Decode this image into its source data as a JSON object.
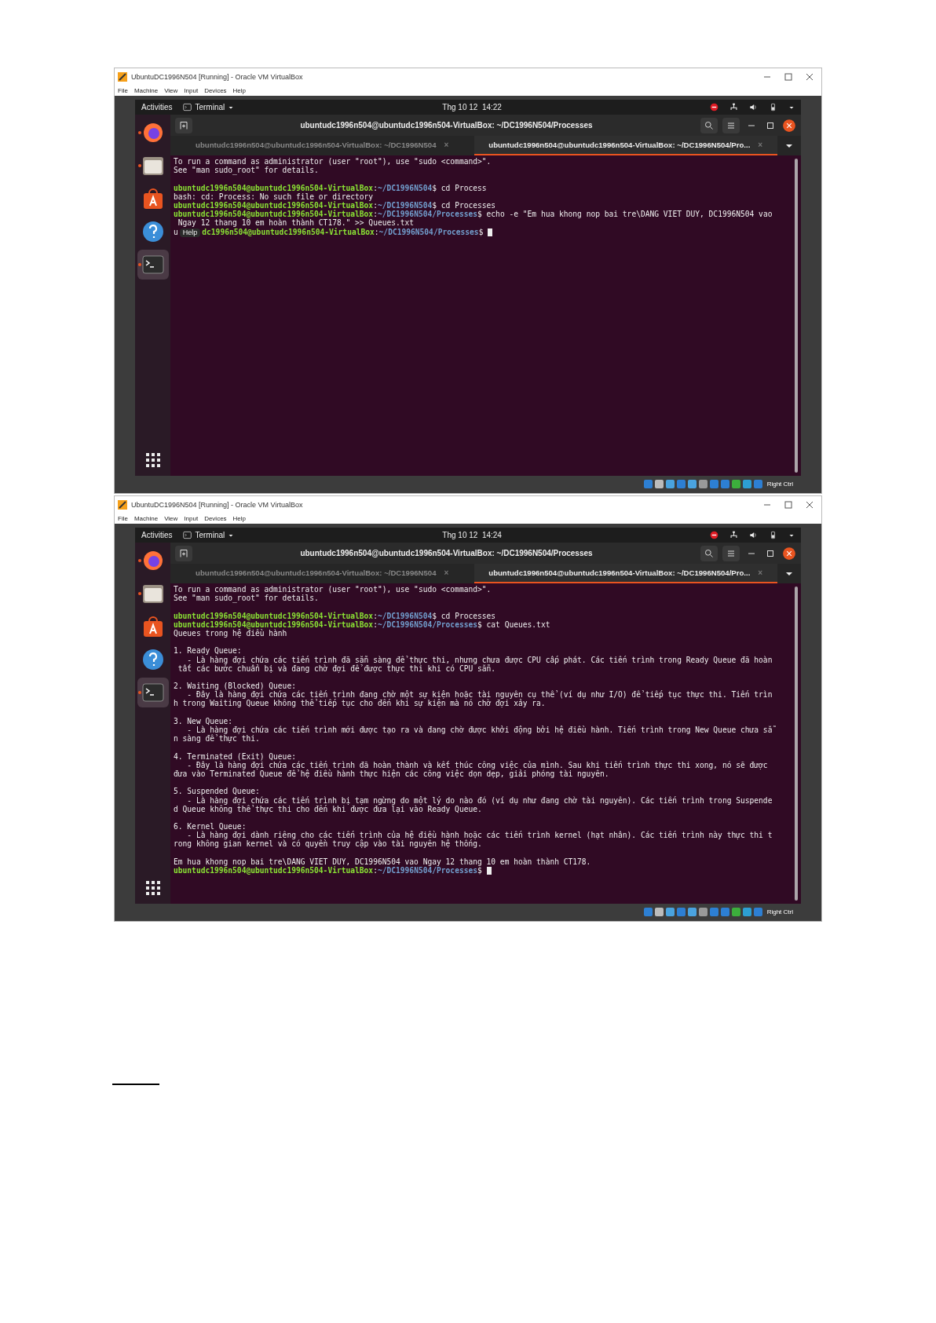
{
  "windows": [
    {
      "title": "UbuntuDC1996N504 [Running] - Oracle VM VirtualBox",
      "menu": [
        "File",
        "Machine",
        "View",
        "Input",
        "Devices",
        "Help"
      ],
      "topbar": {
        "activities": "Activities",
        "app": "Terminal",
        "clock": "Thg 10 12  14:22"
      },
      "dock": [
        {
          "kind": "firefox",
          "running": true,
          "selected": false
        },
        {
          "kind": "files",
          "running": true,
          "selected": false
        },
        {
          "kind": "store",
          "running": false,
          "selected": false
        },
        {
          "kind": "help",
          "running": false,
          "selected": false
        },
        {
          "kind": "terminal",
          "running": true,
          "selected": true
        }
      ],
      "terminal": {
        "title": "ubuntudc1996n504@ubuntudc1996n504-VirtualBox: ~/DC1996N504/Processes",
        "tabs": [
          {
            "label": "ubuntudc1996n504@ubuntudc1996n504-VirtualBox: ~/DC1996N504",
            "close": "×",
            "selected": false
          },
          {
            "label": "ubuntudc1996n504@ubuntudc1996n504-VirtualBox: ~/DC1996N504/Pro...",
            "close": "×",
            "selected": true
          }
        ],
        "lines": [
          {
            "kind": "text",
            "text": "To run a command as administrator (user \"root\"), use \"sudo <command>\"."
          },
          {
            "kind": "text",
            "text": "See \"man sudo_root\" for details."
          },
          {
            "kind": "blank"
          },
          {
            "kind": "prompt",
            "host": "ubuntudc1996n504@ubuntudc1996n504-VirtualBox",
            "sep": ":",
            "path": "~/DC1996N504",
            "command": "$ cd Process"
          },
          {
            "kind": "text",
            "text": "bash: cd: Process: No such file or directory"
          },
          {
            "kind": "prompt",
            "host": "ubuntudc1996n504@ubuntudc1996n504-VirtualBox",
            "sep": ":",
            "path": "~/DC1996N504",
            "command": "$ cd Processes"
          },
          {
            "kind": "prompt",
            "host": "ubuntudc1996n504@ubuntudc1996n504-VirtualBox",
            "sep": ":",
            "path": "~/DC1996N504/Processes",
            "command": "$ echo -e \"Em hua khong nop bai tre\\DANG VIET DUY, DC1996N504 vao"
          },
          {
            "kind": "text",
            "text": " Ngay 12 thang 10 em hoàn thành CT178.\" >> Queues.txt"
          },
          {
            "kind": "prompt",
            "lead": "u",
            "tooltip": "Help",
            "host": "dc1996n504@ubuntudc1996n504-VirtualBox",
            "sep": ":",
            "path": "~/DC1996N504/Processes",
            "command": "$",
            "cursor": true
          }
        ]
      },
      "status": {
        "host_key": "Right Ctrl"
      }
    },
    {
      "title": "UbuntuDC1996N504 [Running] - Oracle VM VirtualBox",
      "menu": [
        "File",
        "Machine",
        "View",
        "Input",
        "Devices",
        "Help"
      ],
      "topbar": {
        "activities": "Activities",
        "app": "Terminal",
        "clock": "Thg 10 12  14:24"
      },
      "dock": [
        {
          "kind": "firefox",
          "running": true,
          "selected": false
        },
        {
          "kind": "files",
          "running": true,
          "selected": false
        },
        {
          "kind": "store",
          "running": false,
          "selected": false
        },
        {
          "kind": "help",
          "running": false,
          "selected": false
        },
        {
          "kind": "terminal",
          "running": true,
          "selected": true
        }
      ],
      "terminal": {
        "title": "ubuntudc1996n504@ubuntudc1996n504-VirtualBox: ~/DC1996N504/Processes",
        "tabs": [
          {
            "label": "ubuntudc1996n504@ubuntudc1996n504-VirtualBox: ~/DC1996N504",
            "close": "×",
            "selected": false
          },
          {
            "label": "ubuntudc1996n504@ubuntudc1996n504-VirtualBox: ~/DC1996N504/Pro...",
            "close": "×",
            "selected": true
          }
        ],
        "lines": [
          {
            "kind": "text",
            "text": "To run a command as administrator (user \"root\"), use \"sudo <command>\"."
          },
          {
            "kind": "text",
            "text": "See \"man sudo_root\" for details."
          },
          {
            "kind": "blank"
          },
          {
            "kind": "prompt",
            "host": "ubuntudc1996n504@ubuntudc1996n504-VirtualBox",
            "sep": ":",
            "path": "~/DC1996N504",
            "command": "$ cd Processes"
          },
          {
            "kind": "prompt",
            "host": "ubuntudc1996n504@ubuntudc1996n504-VirtualBox",
            "sep": ":",
            "path": "~/DC1996N504/Processes",
            "command": "$ cat Queues.txt"
          },
          {
            "kind": "text",
            "text": "Queues trong hệ điều hành"
          },
          {
            "kind": "blank"
          },
          {
            "kind": "text",
            "text": "1. Ready Queue:"
          },
          {
            "kind": "text",
            "text": "   - Là hàng đợi chứa các tiến trình đã sẵn sàng để thực thi, nhưng chưa được CPU cấp phát. Các tiến trình trong Ready Queue đã hoàn"
          },
          {
            "kind": "text",
            "text": " tất các bước chuẩn bị và đang chờ đợi để được thực thi khi có CPU sẵn."
          },
          {
            "kind": "blank"
          },
          {
            "kind": "text",
            "text": "2. Waiting (Blocked) Queue:"
          },
          {
            "kind": "text",
            "text": "   - Đây là hàng đợi chứa các tiến trình đang chờ một sự kiện hoặc tài nguyên cụ thể (ví dụ như I/O) để tiếp tục thực thi. Tiến trìn"
          },
          {
            "kind": "text",
            "text": "h trong Waiting Queue không thể tiếp tục cho đến khi sự kiện mà nó chờ đợi xảy ra."
          },
          {
            "kind": "blank"
          },
          {
            "kind": "text",
            "text": "3. New Queue:"
          },
          {
            "kind": "text",
            "text": "   - Là hàng đợi chứa các tiến trình mới được tạo ra và đang chờ được khởi động bởi hệ điều hành. Tiến trình trong New Queue chưa sẵ"
          },
          {
            "kind": "text",
            "text": "n sàng để thực thi."
          },
          {
            "kind": "blank"
          },
          {
            "kind": "text",
            "text": "4. Terminated (Exit) Queue:"
          },
          {
            "kind": "text",
            "text": "   - Đây là hàng đợi chứa các tiến trình đã hoàn thành và kết thúc công việc của mình. Sau khi tiến trình thực thi xong, nó sẽ được"
          },
          {
            "kind": "text",
            "text": "đưa vào Terminated Queue để hệ điều hành thực hiện các công việc dọn dẹp, giải phóng tài nguyên."
          },
          {
            "kind": "blank"
          },
          {
            "kind": "text",
            "text": "5. Suspended Queue:"
          },
          {
            "kind": "text",
            "text": "   - Là hàng đợi chứa các tiến trình bị tạm ngừng do một lý do nào đó (ví dụ như đang chờ tài nguyên). Các tiến trình trong Suspende"
          },
          {
            "kind": "text",
            "text": "d Queue không thể thực thi cho đến khi được đưa lại vào Ready Queue."
          },
          {
            "kind": "blank"
          },
          {
            "kind": "text",
            "text": "6. Kernel Queue:"
          },
          {
            "kind": "text",
            "text": "   - Là hàng đợi dành riêng cho các tiến trình của hệ điều hành hoặc các tiến trình kernel (hạt nhân). Các tiến trình này thực thi t"
          },
          {
            "kind": "text",
            "text": "rong không gian kernel và có quyền truy cập vào tài nguyên hệ thống."
          },
          {
            "kind": "blank"
          },
          {
            "kind": "text",
            "text": "Em hua khong nop bai tre\\DANG VIET DUY, DC1996N504 vao Ngay 12 thang 10 em hoàn thành CT178."
          },
          {
            "kind": "prompt",
            "host": "ubuntudc1996n504@ubuntudc1996n504-VirtualBox",
            "sep": ":",
            "path": "~/DC1996N504/Processes",
            "command": "$",
            "cursor": true
          }
        ]
      },
      "status": {
        "host_key": "Right Ctrl"
      }
    }
  ]
}
